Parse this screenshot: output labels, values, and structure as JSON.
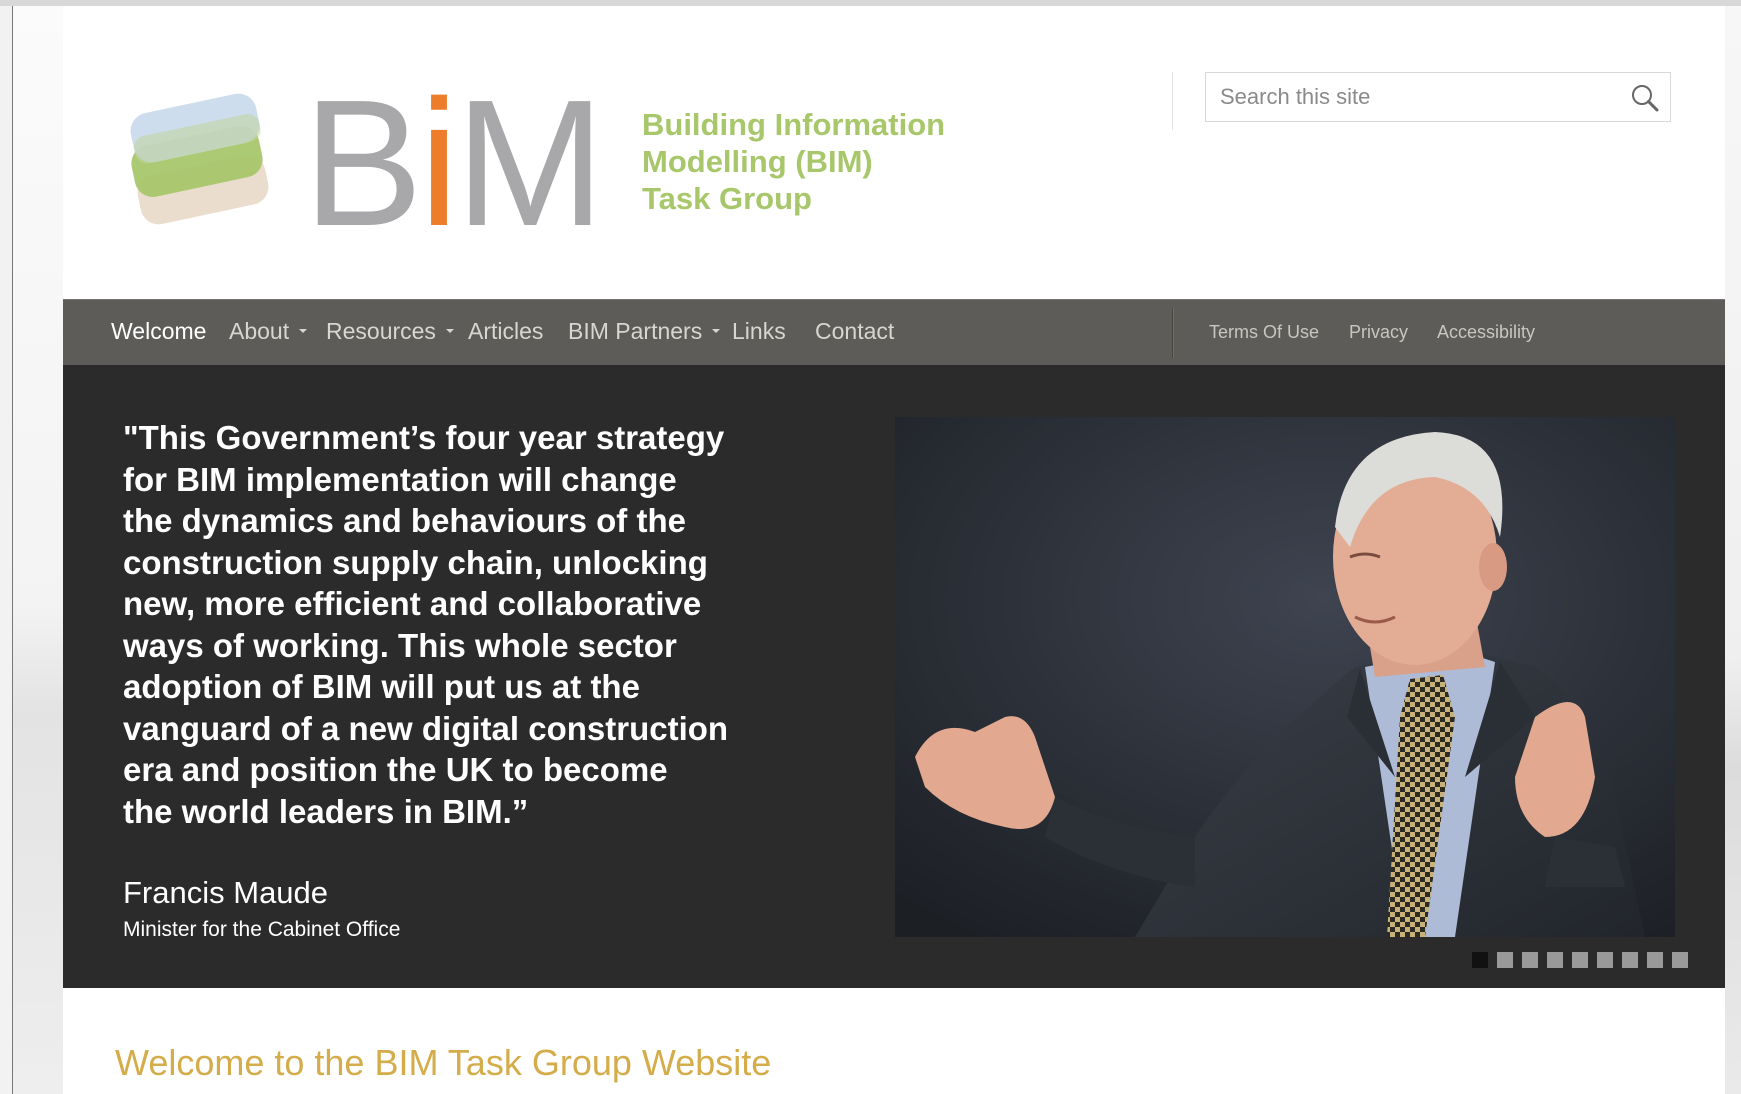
{
  "site": {
    "logo_text": "BiM",
    "tagline": [
      "Building Information",
      "Modelling (BIM)",
      "Task Group"
    ]
  },
  "search": {
    "placeholder": "Search this site",
    "icon": "search-icon"
  },
  "nav": {
    "items": [
      {
        "label": "Welcome",
        "active": true,
        "dropdown": false
      },
      {
        "label": "About",
        "active": false,
        "dropdown": true
      },
      {
        "label": "Resources",
        "active": false,
        "dropdown": true
      },
      {
        "label": "Articles",
        "active": false,
        "dropdown": false
      },
      {
        "label": "BIM Partners",
        "active": false,
        "dropdown": true
      },
      {
        "label": "Links",
        "active": false,
        "dropdown": false
      },
      {
        "label": "Contact",
        "active": false,
        "dropdown": false
      }
    ],
    "utility": [
      {
        "label": "Terms Of Use"
      },
      {
        "label": "Privacy"
      },
      {
        "label": "Accessibility"
      }
    ]
  },
  "hero": {
    "quote_lines": [
      "\"This Government’s four year strategy",
      "for BIM implementation will change",
      "the dynamics and behaviours of the",
      "construction supply chain, unlocking",
      "new, more efficient and collaborative",
      "ways of working. This whole sector",
      "adoption of BIM will put us at the",
      "vanguard of a new digital construction",
      "era and position the UK to become",
      "the world leaders in BIM.”"
    ],
    "author": "Francis Maude",
    "author_role": "Minister for the Cabinet Office",
    "slides_total": 9,
    "active_slide": 1
  },
  "main": {
    "heading": "Welcome to the BIM Task Group Website"
  },
  "colors": {
    "nav_bg": "#5d5c58",
    "hero_bg": "#2b2b2b",
    "tagline": "#a7c76a",
    "logo_i": "#ed7d2a",
    "heading": "#d4ac4a"
  }
}
